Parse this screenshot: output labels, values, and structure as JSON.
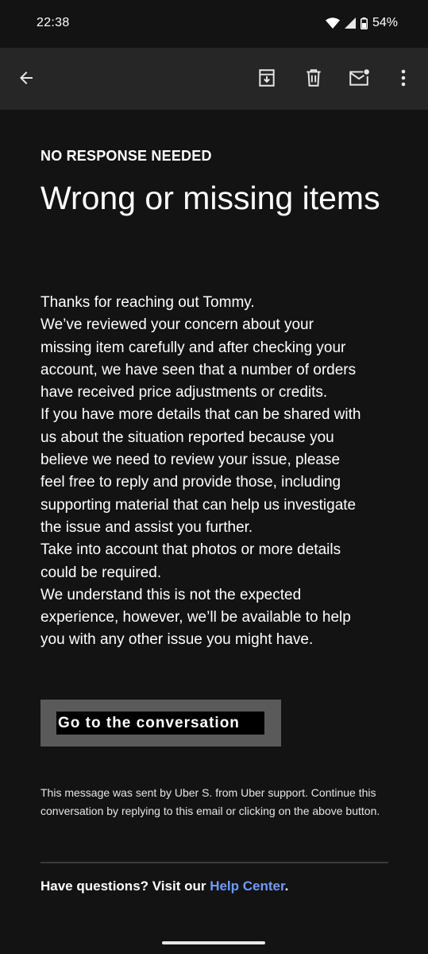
{
  "status_bar": {
    "time": "22:38",
    "battery": "54%",
    "icons": [
      "wifi-icon",
      "signal-icon",
      "battery-icon"
    ]
  },
  "toolbar": {
    "icons": [
      "back-arrow-icon",
      "archive-icon",
      "delete-icon",
      "mark-unread-icon",
      "more-vert-icon"
    ]
  },
  "email": {
    "eyebrow": "NO RESPONSE NEEDED",
    "title": "Wrong or missing items",
    "body_lines": [
      "Thanks for reaching out Tommy.",
      "We’ve reviewed your concern about your",
      "missing item carefully and after checking your",
      "account, we have seen that a number of orders",
      "have received price adjustments or credits.",
      "If you have more details that can be shared with",
      "us about the situation reported because you",
      "believe we need to review your issue, please",
      "feel free to reply and provide those, including",
      "supporting material that can help us investigate",
      "the issue and assist you further.",
      "Take into account that photos or more details",
      "could be required.",
      "We understand this is not the expected",
      "experience, however, we’ll be available to help",
      "you with any other issue you might have."
    ],
    "cta_label": "Go to the conversation",
    "footer_note": "This message was sent by Uber S. from Uber support. Continue this conversation by replying to this email or clicking on the above button.",
    "questions_prefix": "Have questions? Visit our ",
    "help_link": "Help Center",
    "questions_suffix": "."
  },
  "colors": {
    "background": "#131313",
    "toolbar": "#262626",
    "link": "#6f9bff",
    "button_outer": "#5a5a5a",
    "button_inner": "#000000"
  }
}
